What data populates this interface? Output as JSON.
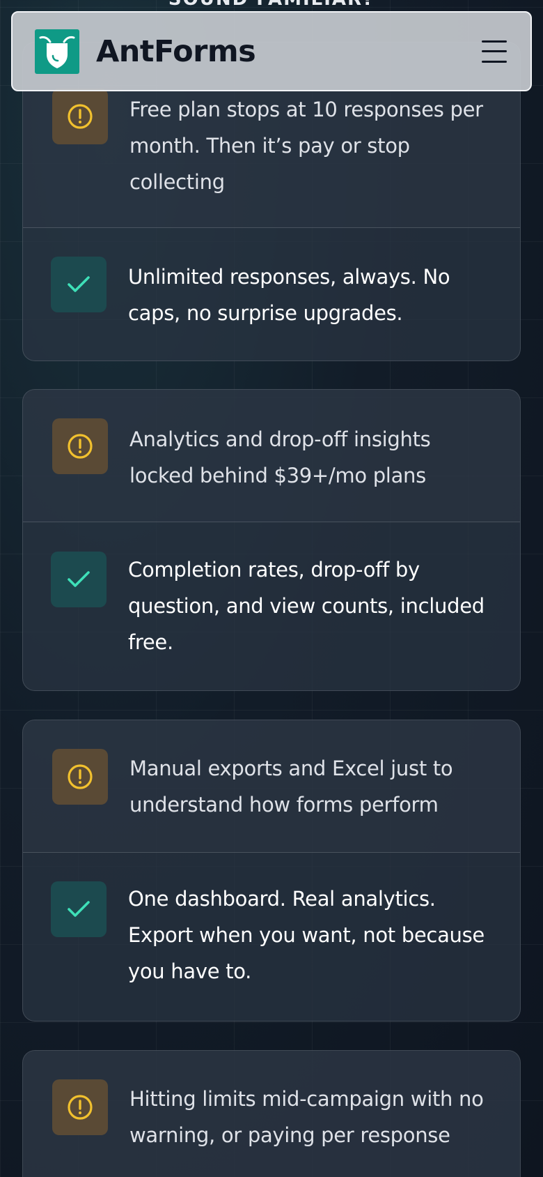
{
  "header": {
    "brand": "AntForms",
    "menu_icon": "hamburger-menu-icon",
    "logo_icon": "ant-shield-logo-icon"
  },
  "section": {
    "heading": "SOUND FAMILIAR?"
  },
  "colors": {
    "accent": "#0f9a86",
    "warning": "#f2c12e",
    "success": "#3ee0b8"
  },
  "comparisons": [
    {
      "problem": "Free plan stops at 10 responses per month. Then it’s pay or stop collecting",
      "problem_icon": "alert-circle-icon",
      "solution": "Unlimited responses, always. No caps, no surprise upgrades.",
      "solution_icon": "check-icon"
    },
    {
      "problem": "Analytics and drop-off insights locked behind $39+/mo plans",
      "problem_icon": "alert-circle-icon",
      "solution": "Completion rates, drop-off by question, and view counts, included free.",
      "solution_icon": "check-icon"
    },
    {
      "problem": "Manual exports and Excel just to understand how forms perform",
      "problem_icon": "alert-circle-icon",
      "solution": "One dashboard. Real analytics. Export when you want, not because you have to.",
      "solution_icon": "check-icon"
    },
    {
      "problem": "Hitting limits mid-campaign with no warning, or paying per response",
      "problem_icon": "alert-circle-icon"
    }
  ]
}
